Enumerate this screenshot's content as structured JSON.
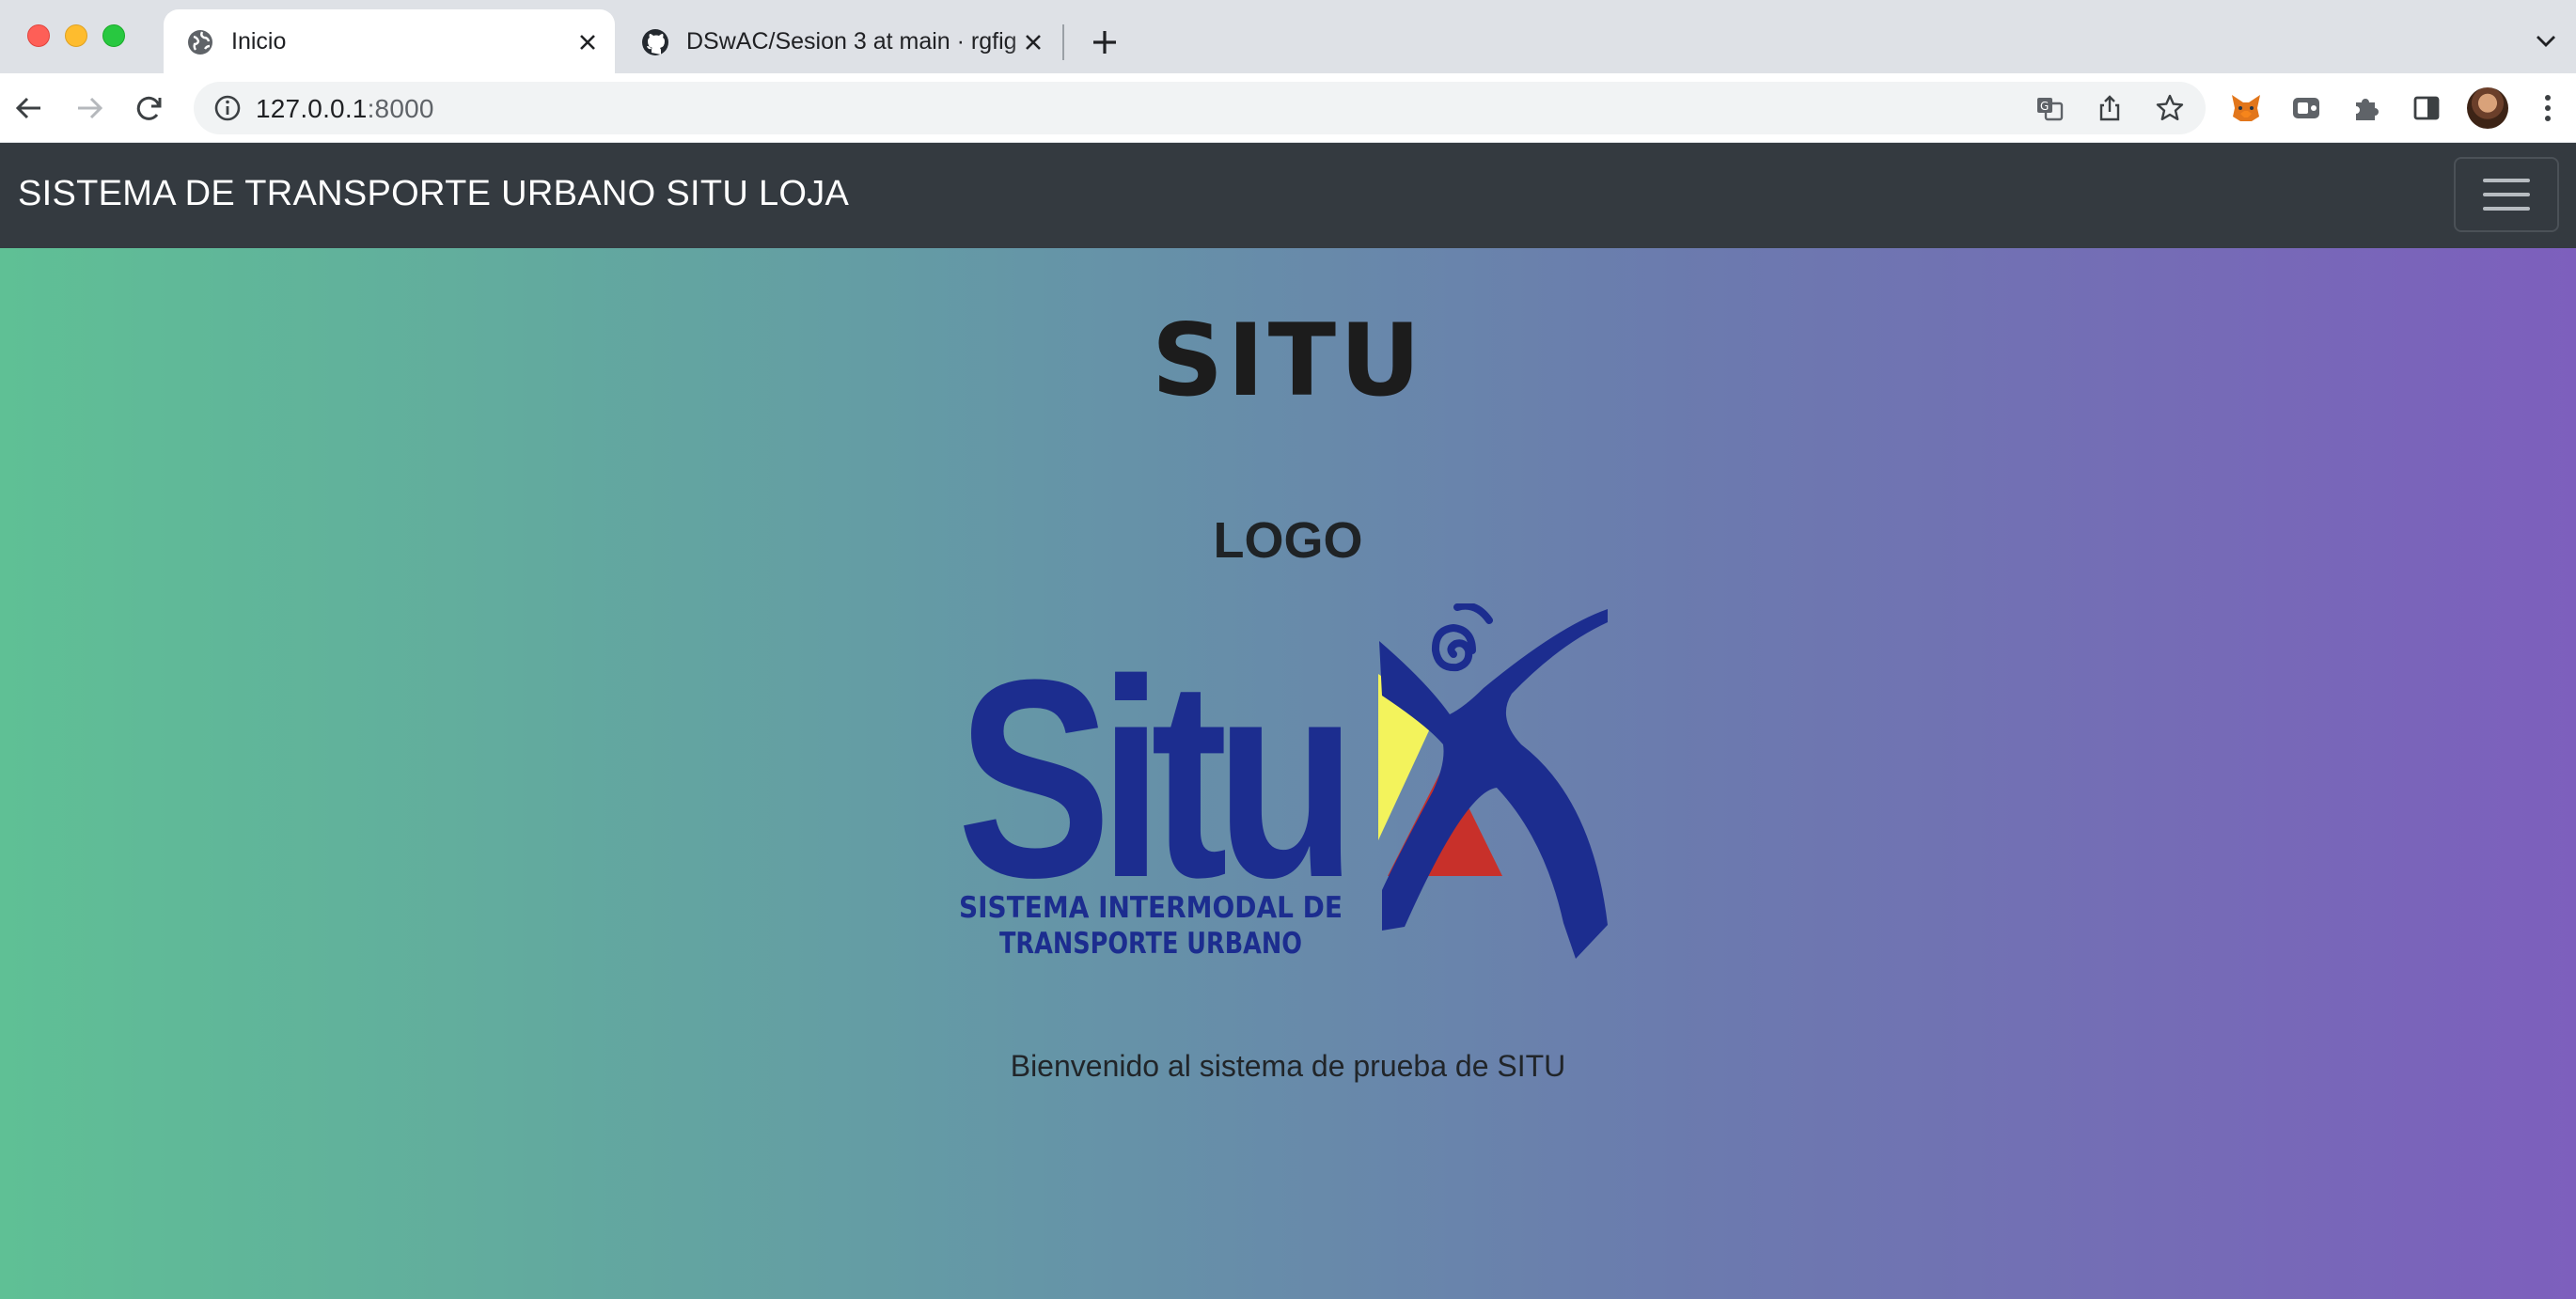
{
  "browser": {
    "tabs": [
      {
        "title": "Inicio",
        "favicon": "globe-icon",
        "active": true
      },
      {
        "title": "DSwAC/Sesion 3 at main · rgfig",
        "favicon": "github-icon",
        "active": false
      }
    ],
    "address": {
      "host": "127.0.0.1",
      "port": ":8000"
    },
    "toolbar_icons": [
      "translate-icon",
      "share-icon",
      "bookmark-star-icon",
      "metamask-extension-icon",
      "extension-icon",
      "puzzle-extensions-icon",
      "side-panel-icon",
      "profile-avatar",
      "more-menu-icon"
    ]
  },
  "navbar": {
    "brand": "SISTEMA DE TRANSPORTE URBANO SITU LOJA",
    "toggler_icon": "hamburger-menu-icon"
  },
  "main": {
    "title": "SITU",
    "logo_heading": "LOGO",
    "logo": {
      "wordmark": "Situ",
      "tagline_line1": "SISTEMA INTERMODAL DE",
      "tagline_line2": "TRANSPORTE URBANO"
    },
    "welcome": "Bienvenido al sistema de prueba de SITU"
  },
  "colors": {
    "navbar_bg": "#343a40",
    "gradient_start": "#5fc095",
    "gradient_end": "#7d5fbd",
    "logo_blue": "#1c2d8f",
    "logo_yellow": "#f3f35c",
    "logo_red": "#c8302a"
  }
}
